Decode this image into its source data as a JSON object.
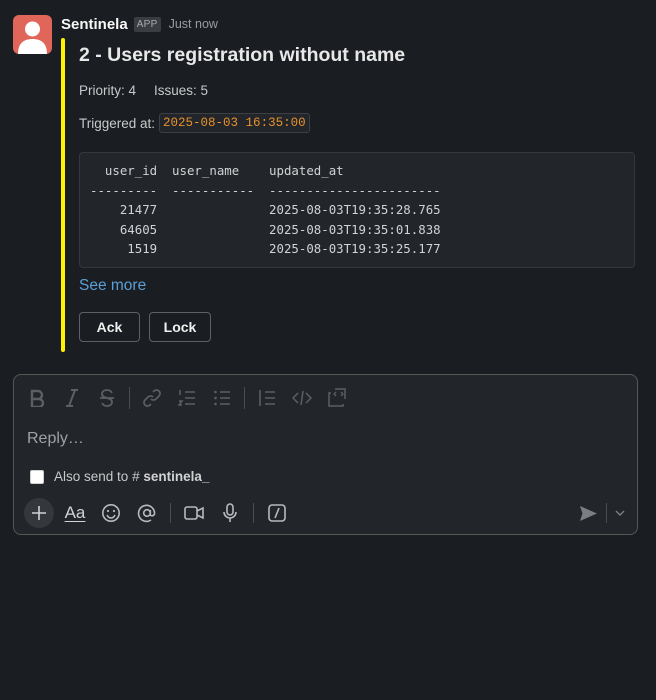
{
  "message": {
    "sender": "Sentinela",
    "badge": "APP",
    "timestamp": "Just now",
    "accent_color": "#fff200",
    "avatar_icon": "user-avatar-icon",
    "title": "2 - Users registration without name",
    "priority": "Priority: 4",
    "issues": "Issues: 5",
    "triggered_label": "Triggered at:",
    "triggered_value": "2025-08-03 16:35:00",
    "code_block": "  user_id  user_name    updated_at\n---------  -----------  -----------------------\n    21477               2025-08-03T19:35:28.765\n    64605               2025-08-03T19:35:01.838\n     1519               2025-08-03T19:35:25.177",
    "see_more": "See more",
    "buttons": {
      "ack": "Ack",
      "lock": "Lock"
    }
  },
  "composer": {
    "placeholder": "Reply…",
    "also_send_prefix": "Also send to",
    "channel_hash": "#",
    "channel": "sentinela_",
    "format_icons": [
      "bold-icon",
      "italic-icon",
      "strikethrough-icon",
      "link-icon",
      "ordered-list-icon",
      "bulleted-list-icon",
      "blockquote-icon",
      "code-icon",
      "code-block-icon"
    ],
    "bottom_icons": [
      "plus-icon",
      "formatting-icon",
      "emoji-icon",
      "mention-icon",
      "video-icon",
      "microphone-icon",
      "slash-command-icon",
      "send-icon",
      "chevron-down-icon"
    ],
    "aa_label": "Aa"
  }
}
